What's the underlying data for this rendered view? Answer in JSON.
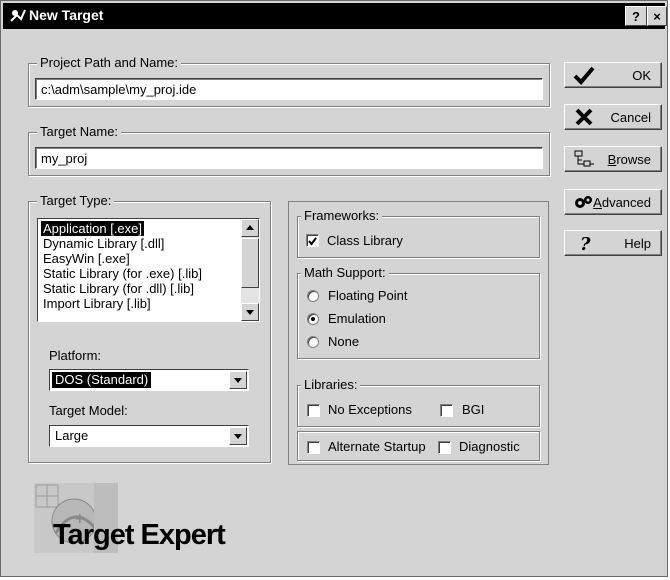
{
  "window": {
    "title": "New Target",
    "help_btn": "?",
    "close_btn": "×"
  },
  "project": {
    "label": "Project Path and Name:",
    "value": "c:\\adm\\sample\\my_proj.ide"
  },
  "target_name": {
    "label": "Target Name:",
    "value": "my_proj"
  },
  "buttons": {
    "ok": "OK",
    "cancel": "Cancel",
    "browse_pre": "",
    "browse_ul": "B",
    "browse_post": "rowse",
    "advanced_ul": "A",
    "advanced_post": "dvanced",
    "help": "Help"
  },
  "target_type": {
    "label": "Target Type:",
    "items": [
      "Application [.exe]",
      "Dynamic Library [.dll]",
      "EasyWin [.exe]",
      "Static Library (for .exe) [.lib]",
      "Static Library (for .dll) [.lib]",
      "Import Library [.lib]"
    ],
    "selected_index": 0
  },
  "platform": {
    "label": "Platform:",
    "value": "DOS (Standard)"
  },
  "target_model": {
    "label": "Target Model:",
    "value": "Large"
  },
  "frameworks": {
    "label": "Frameworks:",
    "class_library": "Class Library",
    "class_library_checked": true
  },
  "math_support": {
    "label": "Math Support:",
    "options": [
      "Floating Point",
      "Emulation",
      "None"
    ],
    "selected": "Emulation"
  },
  "libraries": {
    "label": "Libraries:",
    "no_exceptions": "No Exceptions",
    "no_exceptions_checked": false,
    "bgi": "BGI",
    "bgi_checked": false
  },
  "alternate_startup": {
    "label": "Alternate Startup",
    "checked": false
  },
  "diagnostic": {
    "label": "Diagnostic",
    "checked": false
  },
  "logo": {
    "text": "Target Expert",
    "icon": "target-expert-logo"
  },
  "colors": {
    "title_bar": "#000000",
    "dialog_bg": "#d4d4d4",
    "selection": "#000000"
  }
}
